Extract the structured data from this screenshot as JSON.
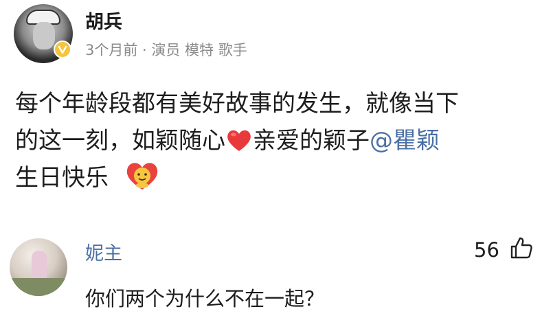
{
  "post": {
    "author": "胡兵",
    "meta": "3个月前 · 演员 模特 歌手",
    "line1": "每个年龄段都有美好故事的发生，就像当下",
    "line2_before": "的这一刻，如颖随心",
    "line2_after": "亲爱的颖子",
    "mention": "@瞿颖",
    "line3": "生日快乐"
  },
  "comment": {
    "author": "妮主",
    "text": "你们两个为什么不在一起？",
    "likes": "56"
  },
  "icons": {
    "verified": "verified-badge-icon",
    "heart": "red-heart-emoji-icon",
    "party": "heart-hug-emoji-icon",
    "like": "thumbs-up-icon"
  },
  "colors": {
    "mention": "#4a6fa5",
    "meta": "#8a8a8a",
    "verified": "#f6c43a"
  }
}
